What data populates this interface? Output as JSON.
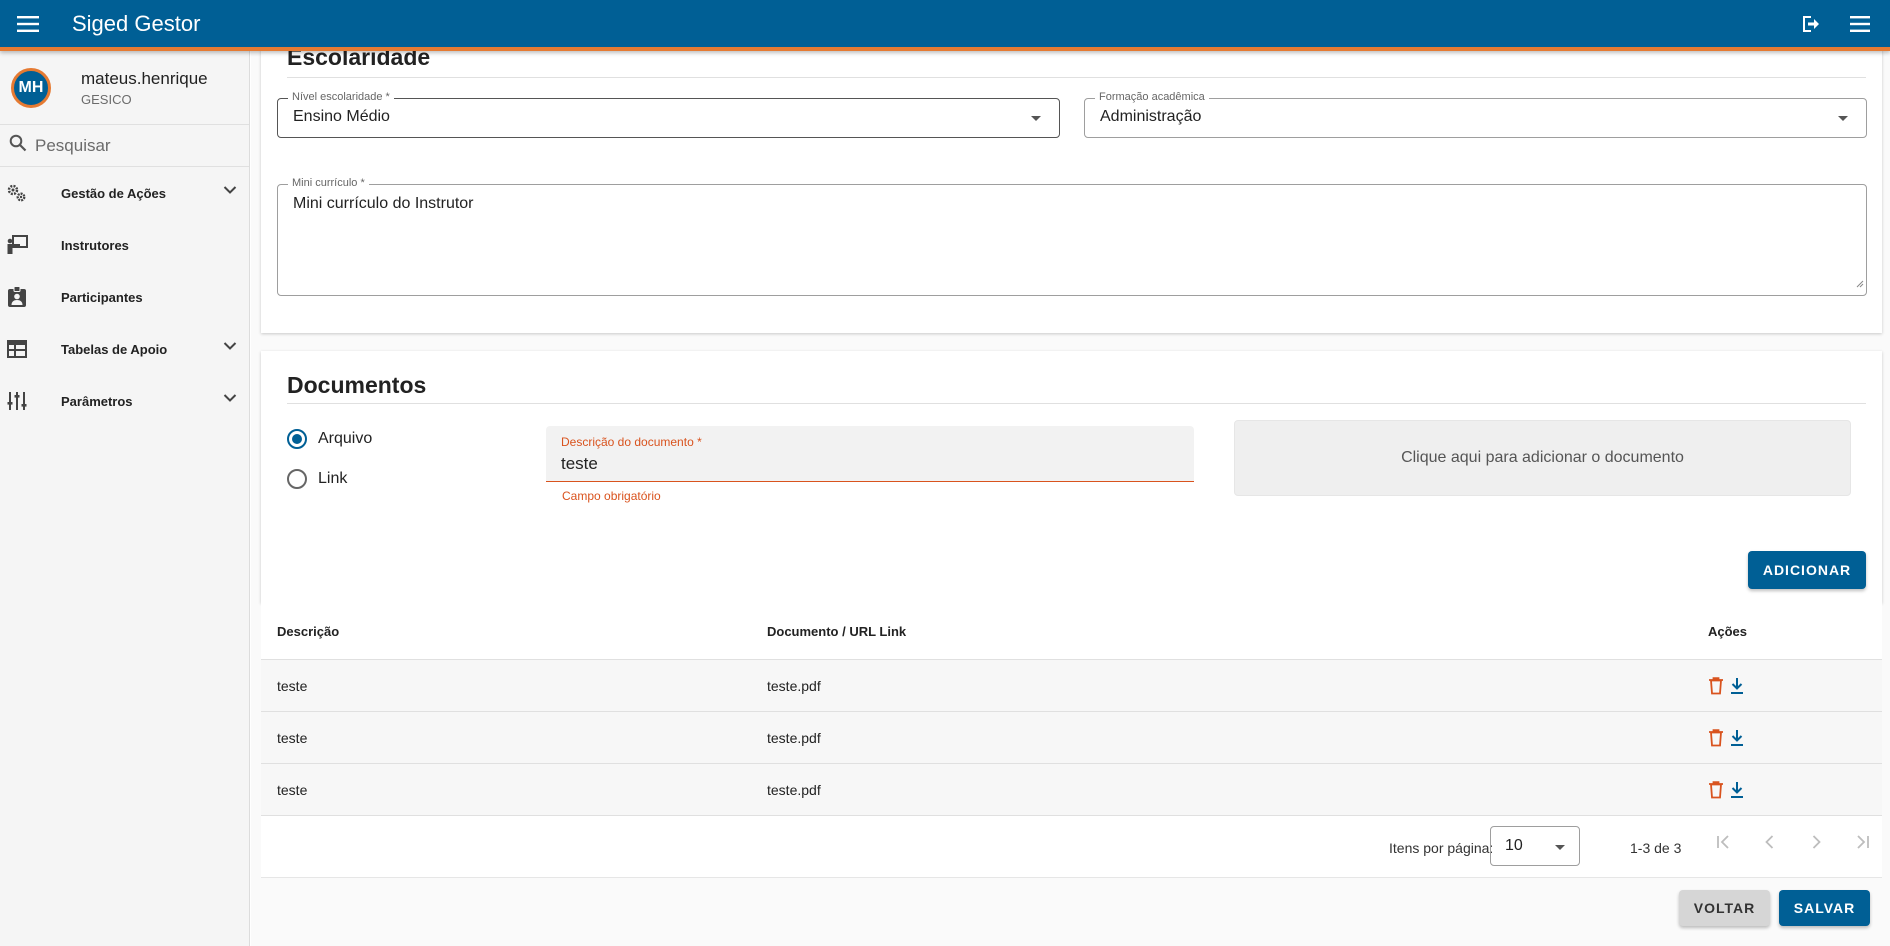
{
  "app": {
    "title": "Siged Gestor"
  },
  "user": {
    "initials": "MH",
    "name": "mateus.henrique",
    "org": "GESICO"
  },
  "search": {
    "placeholder": "Pesquisar"
  },
  "sidebar": {
    "items": [
      {
        "label": "Gestão de Ações",
        "icon": "gears-icon",
        "expandable": true
      },
      {
        "label": "Instrutores",
        "icon": "presenter-icon",
        "expandable": false
      },
      {
        "label": "Participantes",
        "icon": "badge-icon",
        "expandable": false
      },
      {
        "label": "Tabelas de Apoio",
        "icon": "table-icon",
        "expandable": true
      },
      {
        "label": "Parâmetros",
        "icon": "tune-icon",
        "expandable": true
      }
    ]
  },
  "escolaridade": {
    "title": "Escolaridade",
    "nivel": {
      "label": "Nível escolaridade *",
      "value": "Ensino Médio"
    },
    "formacao": {
      "label": "Formação acadêmica",
      "value": "Administração"
    },
    "curriculo": {
      "label": "Mini currículo *",
      "value": "Mini currículo do Instrutor"
    }
  },
  "documentos": {
    "title": "Documentos",
    "radio_arquivo": "Arquivo",
    "radio_link": "Link",
    "descricao": {
      "label": "Descrição do documento *",
      "value": "teste",
      "error": "Campo obrigatório"
    },
    "dropzone": "Clique aqui para adicionar o documento",
    "add_button": "ADICIONAR"
  },
  "table": {
    "headers": [
      "Descrição",
      "Documento / URL Link",
      "Ações"
    ],
    "rows": [
      {
        "descricao": "teste",
        "documento": "teste.pdf"
      },
      {
        "descricao": "teste",
        "documento": "teste.pdf"
      },
      {
        "descricao": "teste",
        "documento": "teste.pdf"
      }
    ]
  },
  "paginator": {
    "label": "Itens por página:",
    "page_size": "10",
    "range": "1-3 de 3"
  },
  "actions": {
    "back": "VOLTAR",
    "save": "SALVAR"
  },
  "colors": {
    "primary": "#005f95",
    "accent": "#e57a32",
    "error": "#d9531e"
  }
}
